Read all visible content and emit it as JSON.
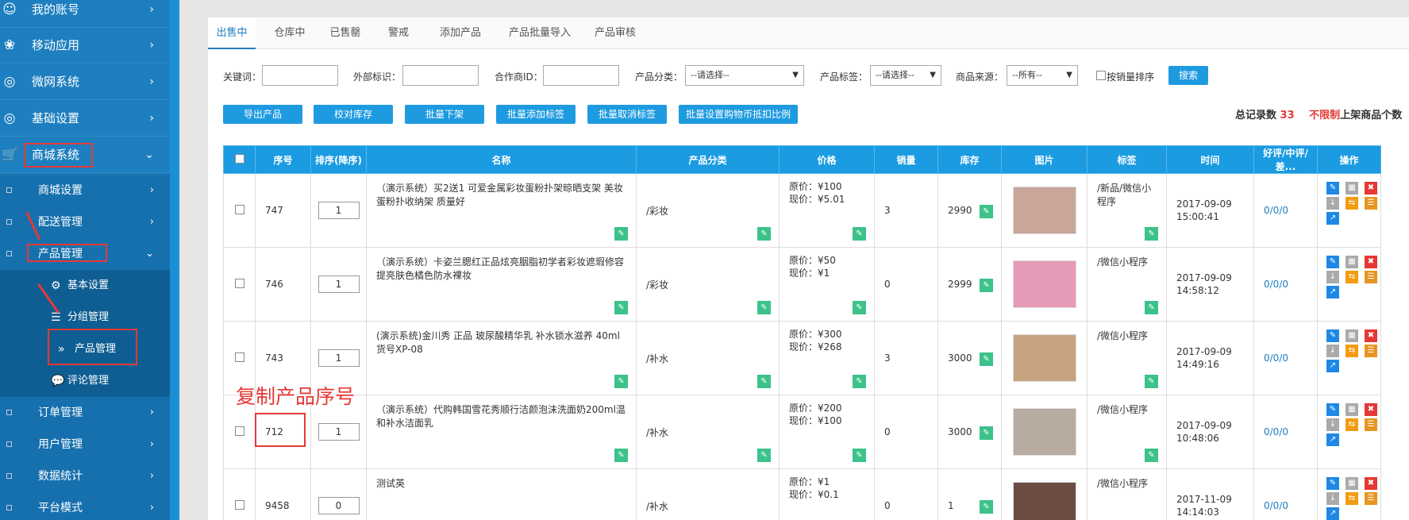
{
  "sidebar": {
    "top_items": [
      {
        "label": "我的账号",
        "icon": "user-icon"
      },
      {
        "label": "移动应用",
        "icon": "apps-icon"
      },
      {
        "label": "微网系统",
        "icon": "globe-icon"
      },
      {
        "label": "基础设置",
        "icon": "globe-icon"
      },
      {
        "label": "商城系统",
        "icon": "cart-icon"
      }
    ],
    "sub_items": [
      {
        "label": "商城设置"
      },
      {
        "label": "配送管理"
      },
      {
        "label": "产品管理"
      },
      {
        "label": "订单管理"
      },
      {
        "label": "用户管理"
      },
      {
        "label": "数据统计"
      },
      {
        "label": "平台模式"
      }
    ],
    "third_items": [
      {
        "label": "基本设置",
        "icon": "gear-icon"
      },
      {
        "label": "分组管理",
        "icon": "list-icon"
      },
      {
        "label": "产品管理",
        "icon": "double-chevron-icon"
      },
      {
        "label": "评论管理",
        "icon": "comment-icon"
      }
    ]
  },
  "annotation": {
    "text": "复制产品序号",
    "color": "#e53935"
  },
  "tabs": [
    "出售中",
    "仓库中",
    "已售罄",
    "警戒",
    "添加产品",
    "产品批量导入",
    "产品审核"
  ],
  "filters": {
    "keyword_label": "关键词：",
    "external_label": "外部标识：",
    "partner_label": "合作商ID：",
    "category_label": "产品分类：",
    "category_value": "--请选择--",
    "tag_label": "产品标签：",
    "tag_value": "--请选择--",
    "source_label": "商品来源：",
    "source_value": "--所有--",
    "sort_by_sales": "按销量排序",
    "search_button": "搜索"
  },
  "actions": [
    "导出产品",
    "校对库存",
    "批量下架",
    "批量添加标签",
    "批量取消标签",
    "批量设置购物币抵扣比例"
  ],
  "summary": {
    "total_label": "总记录数",
    "total_value": "33",
    "unlimited": "不限制",
    "shelf_label": "上架商品个数"
  },
  "table": {
    "headers": [
      "序号",
      "排序(降序)",
      "名称",
      "产品分类",
      "价格",
      "销量",
      "库存",
      "图片",
      "标签",
      "时间",
      "好评/中评/差...",
      "操作"
    ],
    "rows": [
      {
        "id": "747",
        "sort": "1",
        "name": "（演示系统）买2送1 可爱金属彩妆蛋粉扑架晾晒支架 美妆蛋粉扑收纳架 质量好",
        "category": "/彩妆",
        "orig": "原价：¥100",
        "now": "现价：¥5.01",
        "sales": "3",
        "stock": "2990",
        "tag": "/新品/微信小程序",
        "date": "2017-09-09",
        "time": "15:00:41",
        "rating": "0/0/0",
        "img": "#c9a59a"
      },
      {
        "id": "746",
        "sort": "1",
        "name": "（演示系统）卡姿兰腮红正品炫亮胭脂初学者彩妆遮瑕修容提亮肤色橘色防水裸妆",
        "category": "/彩妆",
        "orig": "原价：¥50",
        "now": "现价：¥1",
        "sales": "0",
        "stock": "2999",
        "tag": "/微信小程序",
        "date": "2017-09-09",
        "time": "14:58:12",
        "rating": "0/0/0",
        "img": "#e59ab8"
      },
      {
        "id": "743",
        "sort": "1",
        "name": "(演示系统)金川秀 正品 玻尿酸精华乳 补水锁水滋养 40ml 货号XP-08",
        "category": "/补水",
        "orig": "原价：¥300",
        "now": "现价：¥268",
        "sales": "3",
        "stock": "3000",
        "tag": "/微信小程序",
        "date": "2017-09-09",
        "time": "14:49:16",
        "rating": "0/0/0",
        "img": "#c7a37f"
      },
      {
        "id": "712",
        "sort": "1",
        "name": "（演示系统）代购韩国雪花秀顺行洁颜泡沫洗面奶200ml温和补水洁面乳",
        "category": "/补水",
        "orig": "原价：¥200",
        "now": "现价：¥100",
        "sales": "0",
        "stock": "3000",
        "tag": "/微信小程序",
        "date": "2017-09-09",
        "time": "10:48:06",
        "rating": "0/0/0",
        "img": "#b8aba0"
      },
      {
        "id": "9458",
        "sort": "0",
        "name": "测试英",
        "category": "/补水",
        "orig": "原价：¥1",
        "now": "现价：¥0.1",
        "sales": "0",
        "stock": "1",
        "tag": "/微信小程序",
        "date": "2017-11-09",
        "time": "14:14:03",
        "rating": "0/0/0",
        "img": "#6b4d44"
      }
    ]
  }
}
